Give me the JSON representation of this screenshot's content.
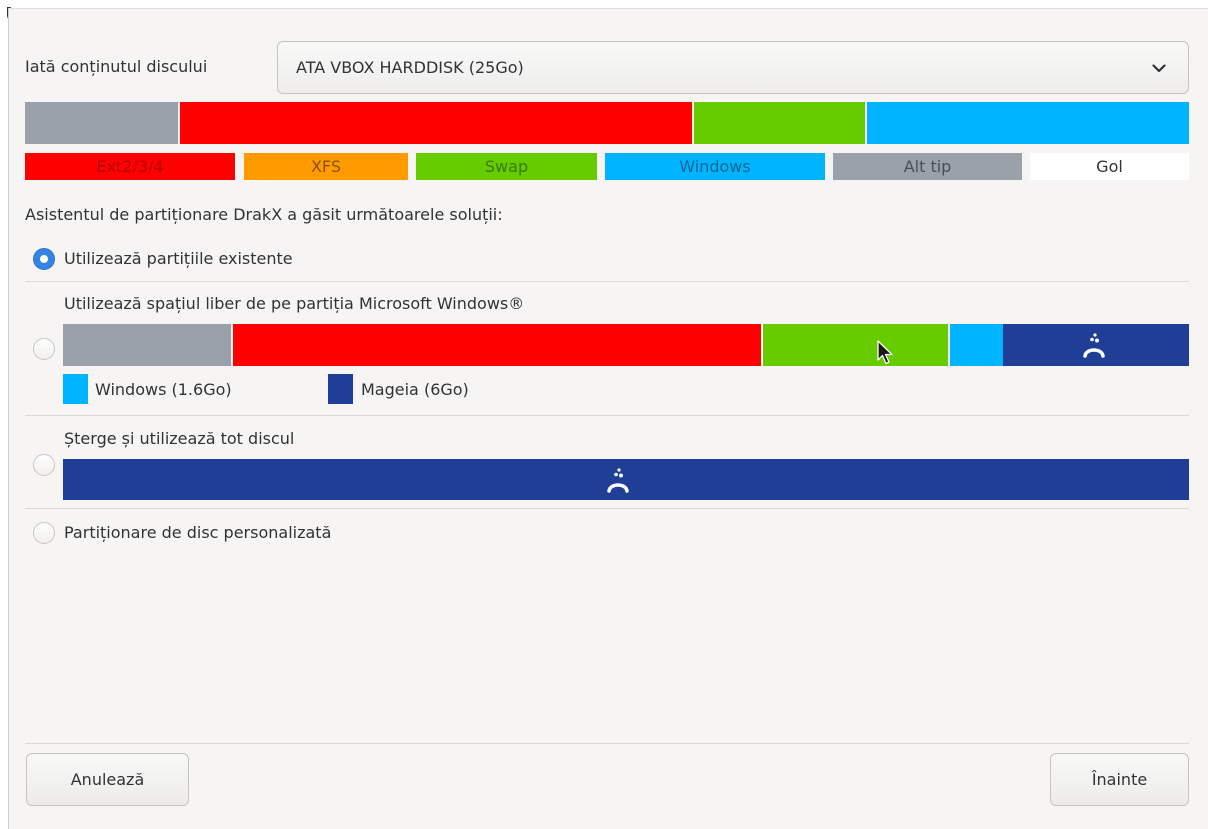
{
  "disk": {
    "label": "Iată conținutul discului",
    "selected": "ATA VBOX HARDDISK (25Go)",
    "dropdown_icon": "chevron-down-icon"
  },
  "legend": {
    "ext": "Ext2/3/4",
    "xfs": "XFS",
    "swap": "Swap",
    "windows": "Windows",
    "other": "Alt tip",
    "empty": "Gol"
  },
  "colors": {
    "ext": "#ff0000",
    "xfs": "#ff9a00",
    "swap": "#66cc00",
    "windows": "#00b4ff",
    "other": "#9aa1ab",
    "empty": "#ffffff",
    "mageia": "#1f3e96",
    "radio_selected": "#3584e4"
  },
  "solutions_heading": "Asistentul de partiționare DrakX a găsit următoarele soluții:",
  "options": {
    "existing": {
      "label": "Utilizează partițiile existente",
      "selected": true
    },
    "free_windows": {
      "label": "Utilizează spațiul liber de pe partiția Microsoft Windows®",
      "selected": false,
      "windows_legend": "Windows (1.6Go)",
      "mageia_legend": "Mageia (6Go)",
      "logo_icon": "mageia-logo-icon"
    },
    "erase": {
      "label": "Șterge și utilizează tot discul",
      "selected": false,
      "logo_icon": "mageia-logo-icon"
    },
    "custom": {
      "label": "Partiționare de disc personalizată",
      "selected": false
    }
  },
  "buttons": {
    "cancel": "Anulează",
    "next": "Înainte"
  }
}
